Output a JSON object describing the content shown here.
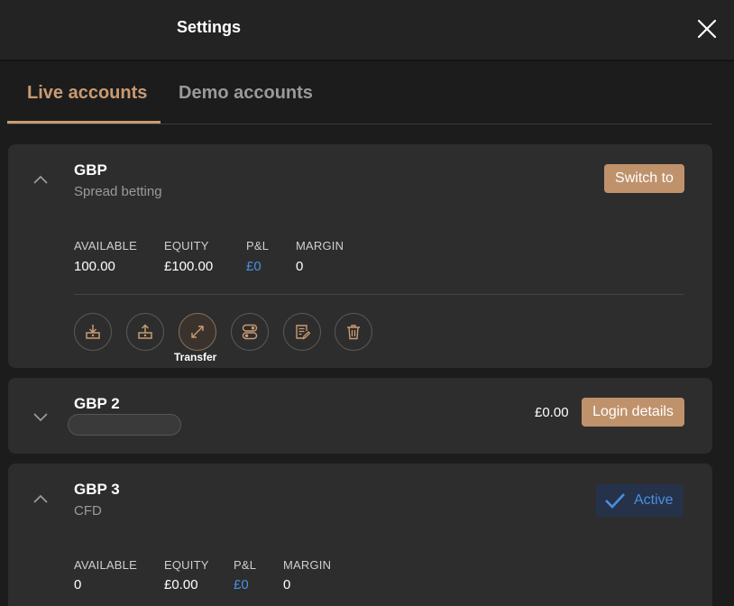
{
  "header": {
    "title": "Settings"
  },
  "tabs": [
    {
      "label": "Live accounts",
      "active": true
    },
    {
      "label": "Demo accounts",
      "active": false
    }
  ],
  "accounts": [
    {
      "name": "GBP",
      "type": "Spread betting",
      "expanded": true,
      "action_label": "Switch to",
      "stats": [
        {
          "label": "AVAILABLE",
          "value": "100.00"
        },
        {
          "label": "EQUITY",
          "value": "£100.00"
        },
        {
          "label": "P&L",
          "value": "£0"
        },
        {
          "label": "MARGIN",
          "value": "0"
        }
      ],
      "actions": [
        {
          "icon": "deposit-icon"
        },
        {
          "icon": "withdraw-icon"
        },
        {
          "icon": "transfer-icon",
          "tooltip": "Transfer"
        },
        {
          "icon": "toggle-settings-icon"
        },
        {
          "icon": "edit-document-icon"
        },
        {
          "icon": "trash-icon"
        }
      ]
    },
    {
      "name": "GBP 2",
      "expanded": false,
      "balance": "£0.00",
      "action_label": "Login details"
    },
    {
      "name": "GBP 3",
      "type": "CFD",
      "expanded": true,
      "status_label": "Active",
      "stats": [
        {
          "label": "AVAILABLE",
          "value": "0"
        },
        {
          "label": "EQUITY",
          "value": "£0.00"
        },
        {
          "label": "P&L",
          "value": "£0"
        },
        {
          "label": "MARGIN",
          "value": "0"
        }
      ]
    }
  ],
  "colors": {
    "accent": "#c99b72",
    "button": "#bf926c",
    "positive": "#4a8fe0",
    "card": "#2d2d2d",
    "background": "#1c1c1c"
  }
}
